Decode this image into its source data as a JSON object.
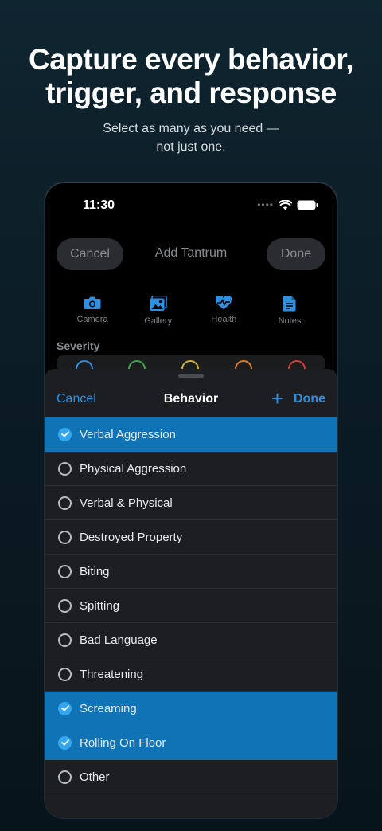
{
  "hero": {
    "title_line1": "Capture every behavior,",
    "title_line2": "trigger, and response",
    "subtitle_line1": "Select as many as you need —",
    "subtitle_line2": "not just one."
  },
  "status_bar": {
    "time": "11:30"
  },
  "nav": {
    "cancel": "Cancel",
    "title": "Add Tantrum",
    "done": "Done"
  },
  "media": [
    {
      "label": "Camera",
      "icon": "camera-icon"
    },
    {
      "label": "Gallery",
      "icon": "gallery-icon"
    },
    {
      "label": "Health",
      "icon": "health-icon"
    },
    {
      "label": "Notes",
      "icon": "notes-icon"
    }
  ],
  "severity": {
    "label": "Severity",
    "colors": [
      "#2f8fe0",
      "#3fa24a",
      "#d1b12b",
      "#e07d1f",
      "#d63a35"
    ]
  },
  "sheet": {
    "cancel": "Cancel",
    "title": "Behavior",
    "add": "+",
    "done": "Done",
    "items": [
      {
        "label": "Verbal Aggression",
        "selected": true
      },
      {
        "label": "Physical Aggression",
        "selected": false
      },
      {
        "label": "Verbal & Physical",
        "selected": false
      },
      {
        "label": "Destroyed Property",
        "selected": false
      },
      {
        "label": "Biting",
        "selected": false
      },
      {
        "label": "Spitting",
        "selected": false
      },
      {
        "label": "Bad Language",
        "selected": false
      },
      {
        "label": "Threatening",
        "selected": false
      },
      {
        "label": "Screaming",
        "selected": true
      },
      {
        "label": "Rolling On Floor",
        "selected": true
      },
      {
        "label": "Other",
        "selected": false
      }
    ]
  },
  "colors": {
    "accent": "#2c8fe0",
    "selected_row": "#0f73b6",
    "check": "#35a7ee"
  }
}
